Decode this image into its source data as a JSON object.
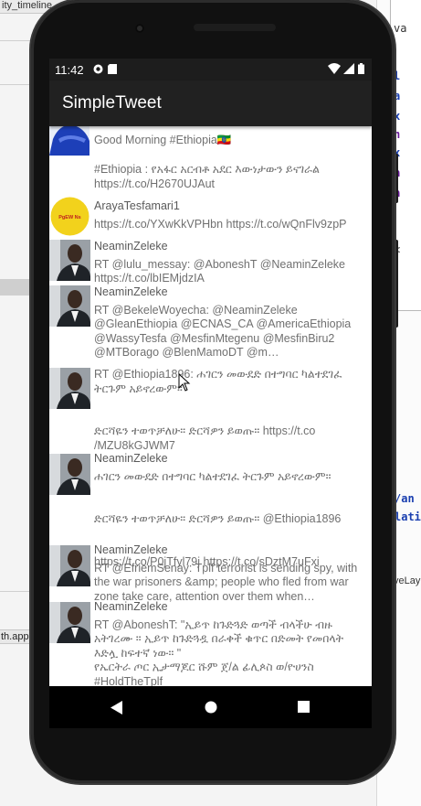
{
  "ide": {
    "tab_title": "ity_timeline",
    "status_file": "th.app",
    "right_snippets": [
      "va",
      "/an",
      "lati",
      "veLay"
    ]
  },
  "status_bar": {
    "time": "11:42"
  },
  "app": {
    "title": "SimpleTweet"
  },
  "tweets": [
    {
      "username": "",
      "text": "Good Morning #Ethiopia🇪🇹",
      "avatar": "blue-avatar"
    },
    {
      "username": "",
      "text": "#Ethiopia : የአፋር አርብቶ አደር እውነታውን ይናገራል\nhttps://t.co/H2670UJAut",
      "avatar": "none"
    },
    {
      "username": "ArayaTesfamari1",
      "text": "https://t.co/YXwKkVPHbn https://t.co/wQnFlv9zpP",
      "avatar": "yellow-logo"
    },
    {
      "username": "NeaminZeleke",
      "text": "RT @lulu_messay: @AboneshT @NeaminZeleke\nhttps://t.co/lbIEMjdzIA",
      "avatar": "man-photo"
    },
    {
      "username": "NeaminZeleke",
      "text": "RT @BekeleWoyecha: @NeaminZeleke\n@GleanEthiopia @ECNAS_CA @AmericaEthiopia\n@WassyTesfa @MesfinMtegenu @MesfinBiru2\n@MTBorago @BlenMamoDT @m…",
      "avatar": "man-photo"
    },
    {
      "username": "NeaminZeleke",
      "text": "RT @Ethiopia1896: ሐገርን መውደድ በተግባር ካልተደገፈ\nትርጉም አይኖረውም።\n\n\nድርሻዬን ተወጥቻለሁ። ድርሻዎን ይወጡ። https://t.co\n/MZU8kGJWM7",
      "avatar": "man-photo"
    },
    {
      "username": "NeaminZeleke",
      "text": "ሐገርን መውደድ በተግባር ካልተደገፈ ትርጉም አይኖረውም።\n\n\nድርሻዬን ተወጥቻለሁ። ድርሻዎን ይወጡ። @Ethiopia1896\n\n\nhttps://t.co/P0jTfyl79j https://t.co/sDztM7uFxi",
      "avatar": "man-photo"
    },
    {
      "username": "NeaminZeleke",
      "text": "RT @EfriemSenay: Tplf terrorist is sending spy, with\nthe war prisoners &amp; people who fled from war\nzone take care, attention over them when…",
      "avatar": "man-photo"
    },
    {
      "username": "NeaminZeleke",
      "text": "RT @AboneshT: \"ኢይጥ ከጉድጓድ ወጣች ብላችሁ ብዙ\nአትገረሙ ። ኢይጥ ከጉድጓዷ በራቀች ቁጥር በድመት የመበላት\nእድሏ ከፍተኛ ነው። \"\nየኤርትራ ጦር ኢታማጆር ሹም ጀ/ል ፊሊጶስ ወ/ዮሀንስ\n#HoldTheTplf",
      "avatar": "man-photo"
    }
  ],
  "colors": {
    "app_bar": "#212121",
    "status_bar": "#1d1d1d",
    "nav_bar": "#000000",
    "text": "#707070"
  }
}
